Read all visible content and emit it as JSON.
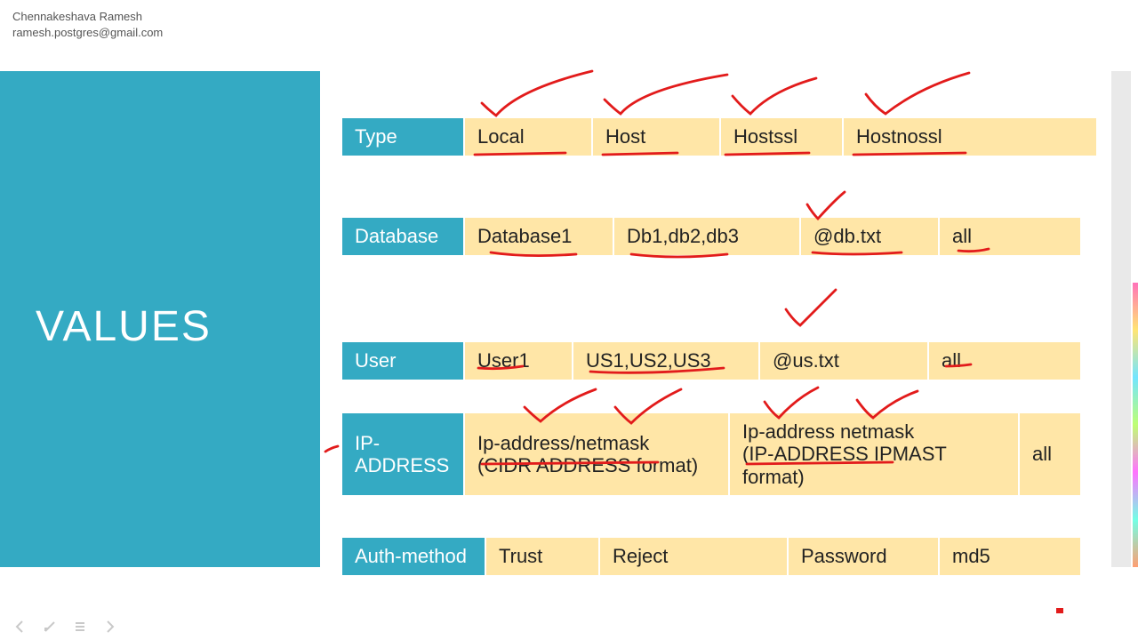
{
  "header": {
    "name": "Chennakeshava Ramesh",
    "email": "ramesh.postgres@gmail.com"
  },
  "sidebar": {
    "title": "VALUES"
  },
  "rows": {
    "type": {
      "label": "Type",
      "cells": [
        "Local",
        "Host",
        "Hostssl",
        "Hostnossl"
      ]
    },
    "database": {
      "label": "Database",
      "cells": [
        "Database1",
        "Db1,db2,db3",
        "@db.txt",
        "all"
      ]
    },
    "user": {
      "label": "User",
      "cells": [
        "User1",
        "US1,US2,US3",
        "@us.txt",
        "all"
      ]
    },
    "ip": {
      "label_line1": "IP-",
      "label_line2": "ADDRESS",
      "c1_line1": "Ip-address/netmask",
      "c1_line2": "(CIDR ADDRESS format)",
      "c2_line1": "Ip-address netmask",
      "c2_line2": "(IP-ADDRESS IPMAST format)",
      "c3": "all"
    },
    "auth": {
      "label": "Auth-method",
      "cells": [
        "Trust",
        "Reject",
        "Password",
        "md5"
      ]
    }
  },
  "colors": {
    "teal": "#34aac3",
    "cream": "#ffe6a7",
    "red": "#e21b1b"
  }
}
